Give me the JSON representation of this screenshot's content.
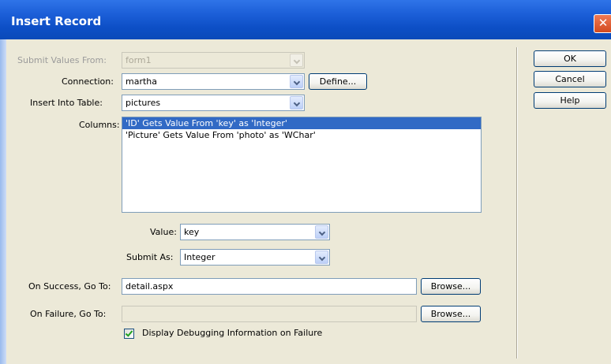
{
  "window": {
    "title": "Insert Record",
    "close_glyph": "✕"
  },
  "form": {
    "submit_from": {
      "label": "Submit Values From:",
      "value": "form1"
    },
    "connection": {
      "label": "Connection:",
      "value": "martha",
      "define_label": "Define..."
    },
    "table": {
      "label": "Insert Into Table:",
      "value": "pictures"
    },
    "columns": {
      "label": "Columns:",
      "items": [
        "'ID' Gets Value From 'key' as 'Integer'",
        "'Picture' Gets Value From 'photo' as 'WChar'"
      ],
      "selected_index": 0
    },
    "value": {
      "label": "Value:",
      "value": "key"
    },
    "submit_as": {
      "label": "Submit As:",
      "value": "Integer"
    },
    "on_success": {
      "label": "On Success, Go To:",
      "value": "detail.aspx",
      "browse_label": "Browse..."
    },
    "on_failure": {
      "label": "On Failure, Go To:",
      "value": "",
      "browse_label": "Browse..."
    },
    "debug": {
      "label": "Display Debugging Information on Failure",
      "checked": true
    }
  },
  "buttons": {
    "ok": "OK",
    "cancel": "Cancel",
    "help": "Help"
  },
  "icons": {
    "close": "close-icon",
    "dropdown": "chevron-down-icon",
    "check": "checkmark-icon"
  }
}
